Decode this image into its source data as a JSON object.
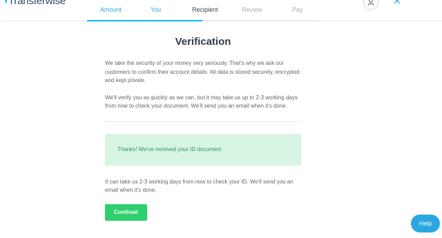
{
  "brand": {
    "name": "Transferwise",
    "flag_icon": "flag-icon"
  },
  "steps": [
    {
      "label": "Amount",
      "state": "done"
    },
    {
      "label": "You",
      "state": "done"
    },
    {
      "label": "Recipient",
      "state": "active"
    },
    {
      "label": "Review",
      "state": "todo"
    },
    {
      "label": "Pay",
      "state": "todo"
    }
  ],
  "progress": {
    "completed_fraction": 0.5
  },
  "header": {
    "account_icon": "user-icon",
    "close_icon": "close-icon"
  },
  "main": {
    "title": "Verification",
    "para1": "We take the security of your money very seriously. That's why we ask our customers to confirm their account details. All data is stored securely, encrypted and kept private.",
    "para2": "We'll verify you as quickly as we can, but it may take us up to 2-3 working days from now to check your document. We'll send you an email when it's done.",
    "alert": "Thanks! We've received your ID document",
    "note": "It can take us 2-3 working days from now to check your ID. We'll send you an email when it's done.",
    "continue_label": "Continue"
  },
  "help": {
    "label": "Help"
  },
  "colors": {
    "accent": "#00b9ff",
    "success_bg": "#d8f4e2",
    "success_text": "#2d9b56",
    "button": "#2ed06e",
    "help": "#2aa7e0"
  }
}
